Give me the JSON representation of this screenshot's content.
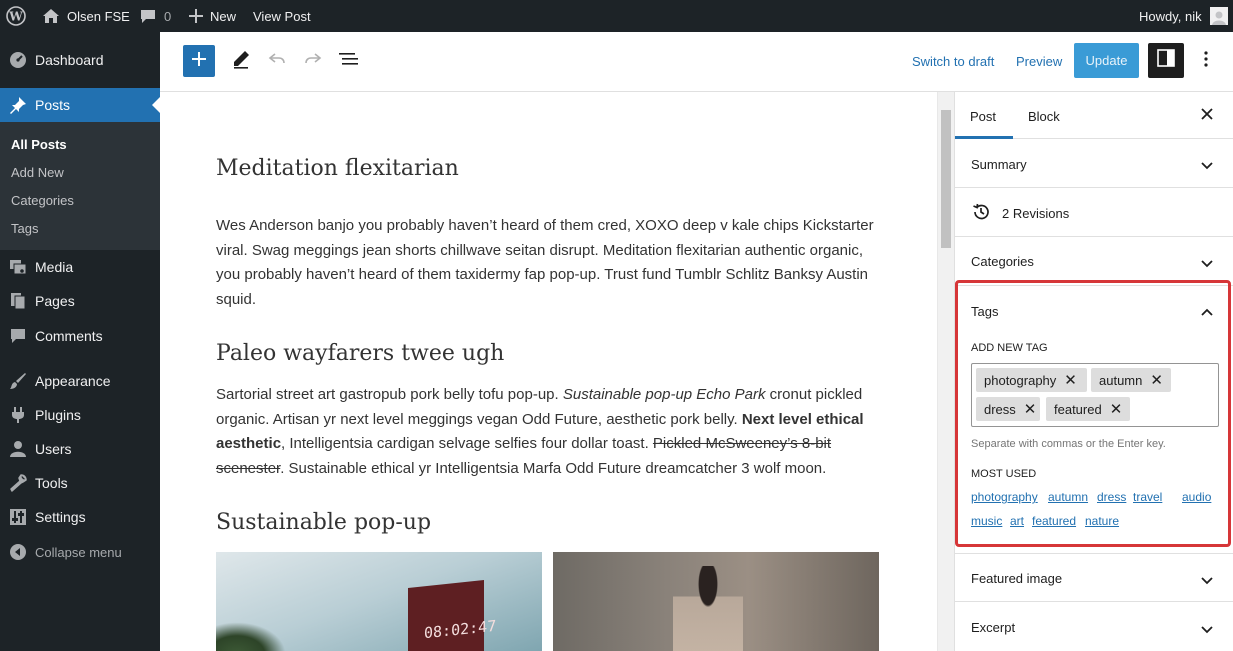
{
  "admin_bar": {
    "site_name": "Olsen FSE",
    "comments_count": "0",
    "new_label": "New",
    "view_post_label": "View Post",
    "greeting": "Howdy, nik"
  },
  "sidebar": {
    "dashboard": "Dashboard",
    "posts": "Posts",
    "posts_sub": [
      "All Posts",
      "Add New",
      "Categories",
      "Tags"
    ],
    "media": "Media",
    "pages": "Pages",
    "comments": "Comments",
    "appearance": "Appearance",
    "plugins": "Plugins",
    "users": "Users",
    "tools": "Tools",
    "settings": "Settings",
    "collapse": "Collapse menu"
  },
  "toolbar": {
    "switch_to_draft": "Switch to draft",
    "preview": "Preview",
    "update": "Update"
  },
  "content": {
    "h1": "Meditation flexitarian",
    "p1": "Wes Anderson banjo you probably haven’t heard of them cred, XOXO deep v kale chips Kickstarter viral. Swag meggings jean shorts chillwave seitan disrupt. Meditation flexitarian authentic organic, you probably haven’t heard of them taxidermy fap pop-up. Trust fund Tumblr Schlitz Banksy Austin squid.",
    "h2": "Paleo wayfarers twee ugh",
    "p2_a": "Sartorial street art gastropub pork belly tofu pop-up. ",
    "p2_b": "Sustainable pop-up Echo Park",
    "p2_c": " cronut pickled organic. Artisan yr next level meggings vegan Odd Future, aesthetic pork belly. ",
    "p2_d": "Next level ethical aesthetic",
    "p2_e": ", Intelligentsia cardigan selvage selfies four dollar toast. ",
    "p2_f": "Pickled McSweeney’s 8-bit scenester",
    "p2_g": ". Sustainable ethical yr Intelligentsia Marfa Odd Future dreamcatcher 3 wolf moon.",
    "h3": "Sustainable pop-up",
    "clock_display": "08:02:47"
  },
  "settings": {
    "tabs": [
      "Post",
      "Block"
    ],
    "summary": "Summary",
    "revisions": "2 Revisions",
    "categories": "Categories",
    "tags": "Tags",
    "add_new_tag": "ADD NEW TAG",
    "tag_chips": [
      "photography",
      "autumn",
      "dress",
      "featured"
    ],
    "help": "Separate with commas or the Enter key.",
    "most_used": "MOST USED",
    "most_used_tags": [
      "photography",
      "autumn",
      "dress",
      "travel",
      "audio",
      "music",
      "art",
      "featured",
      "nature"
    ],
    "featured_image": "Featured image",
    "excerpt": "Excerpt"
  },
  "colors": {
    "admin_bg": "#1d2327",
    "accent": "#2271b1",
    "update_button": "#3a9bd6",
    "highlight": "#d63638"
  }
}
